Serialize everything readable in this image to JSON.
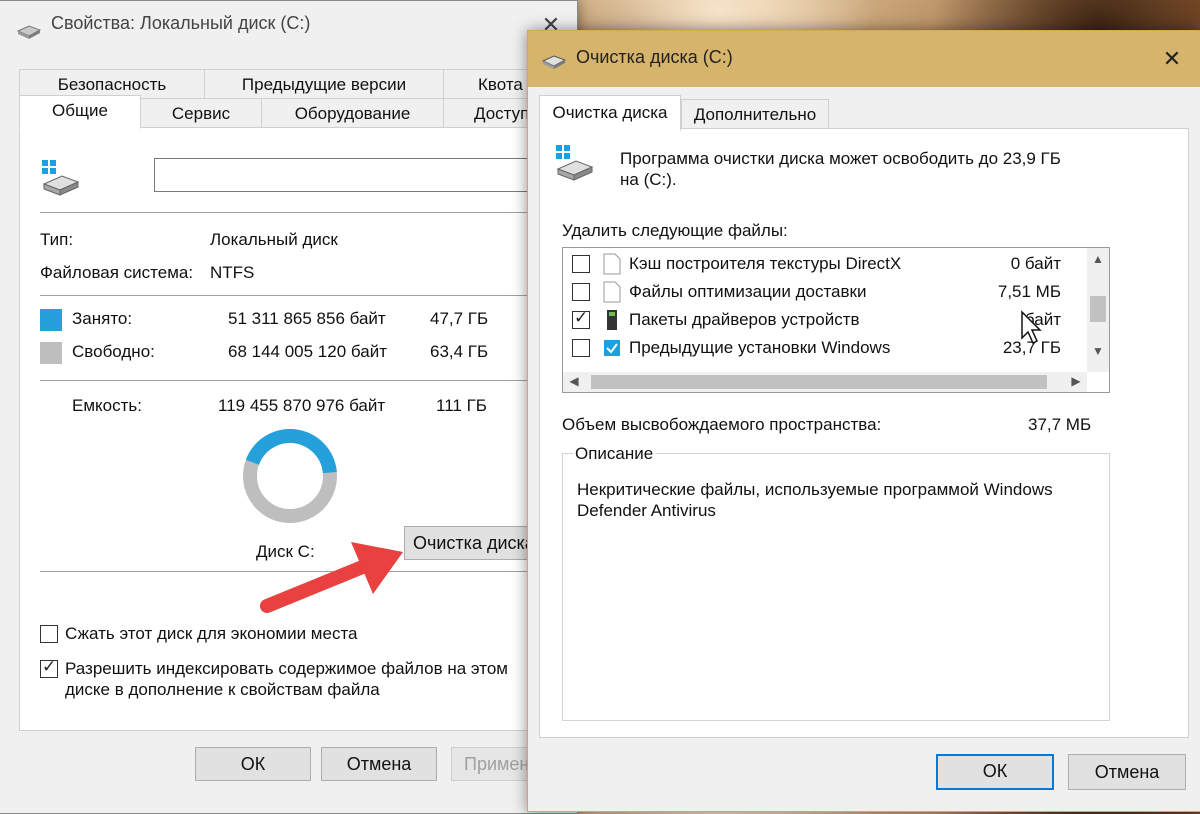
{
  "props": {
    "title": "Свойства: Локальный диск (C:)",
    "tabs_row1": [
      "Безопасность",
      "Предыдущие версии",
      "Квота"
    ],
    "tabs_row2": [
      "Общие",
      "Сервис",
      "Оборудование",
      "Доступ"
    ],
    "name_value": "",
    "type_label": "Тип:",
    "type_value": "Локальный диск",
    "fs_label": "Файловая система:",
    "fs_value": "NTFS",
    "used_label": "Занято:",
    "used_bytes": "51 311 865 856 байт",
    "used_gb": "47,7 ГБ",
    "free_label": "Свободно:",
    "free_bytes": "68 144 005 120 байт",
    "free_gb": "63,4 ГБ",
    "capacity_label": "Емкость:",
    "capacity_bytes": "119 455 870 976 байт",
    "capacity_gb": "111 ГБ",
    "used_fraction": 0.43,
    "disk_label": "Диск C:",
    "cleanup_button": "Очистка диска",
    "compress_label": "Сжать этот диск для экономии места",
    "compress_checked": false,
    "index_label_line1": "Разрешить индексировать содержимое файлов на этом",
    "index_label_line2": "диске в дополнение к свойствам файла",
    "index_checked": true,
    "ok": "ОК",
    "cancel": "Отмена",
    "apply": "Примен"
  },
  "cleanup": {
    "title": "Очистка диска  (C:)",
    "tabs": [
      "Очистка диска",
      "Дополнительно"
    ],
    "intro_line1": "Программа очистки диска может освободить до 23,9 ГБ",
    "intro_line2": "на  (C:).",
    "delete_label": "Удалить следующие файлы:",
    "files": [
      {
        "name": "Кэш построителя текстуры DirectX",
        "size": "0 байт",
        "checked": false,
        "icon": "file-icon"
      },
      {
        "name": "Файлы оптимизации доставки",
        "size": "7,51 МБ",
        "checked": false,
        "icon": "file-icon"
      },
      {
        "name": "Пакеты драйверов устройств",
        "size": "байт",
        "checked": true,
        "icon": "driver-package-icon"
      },
      {
        "name": "Предыдущие установки Windows",
        "size": "23,7 ГБ",
        "checked": false,
        "icon": "windows-setup-icon"
      }
    ],
    "space_label": "Объем высвобождаемого пространства:",
    "space_value": "37,7 МБ",
    "description_title": "Описание",
    "description_line1": "Некритические файлы, используемые программой Windows",
    "description_line2": "Defender Antivirus",
    "ok": "ОК",
    "cancel": "Отмена"
  },
  "colors": {
    "used": "#26a0da",
    "free": "#bebebe",
    "focus": "#0078d7",
    "arrow": "#e8413f"
  }
}
